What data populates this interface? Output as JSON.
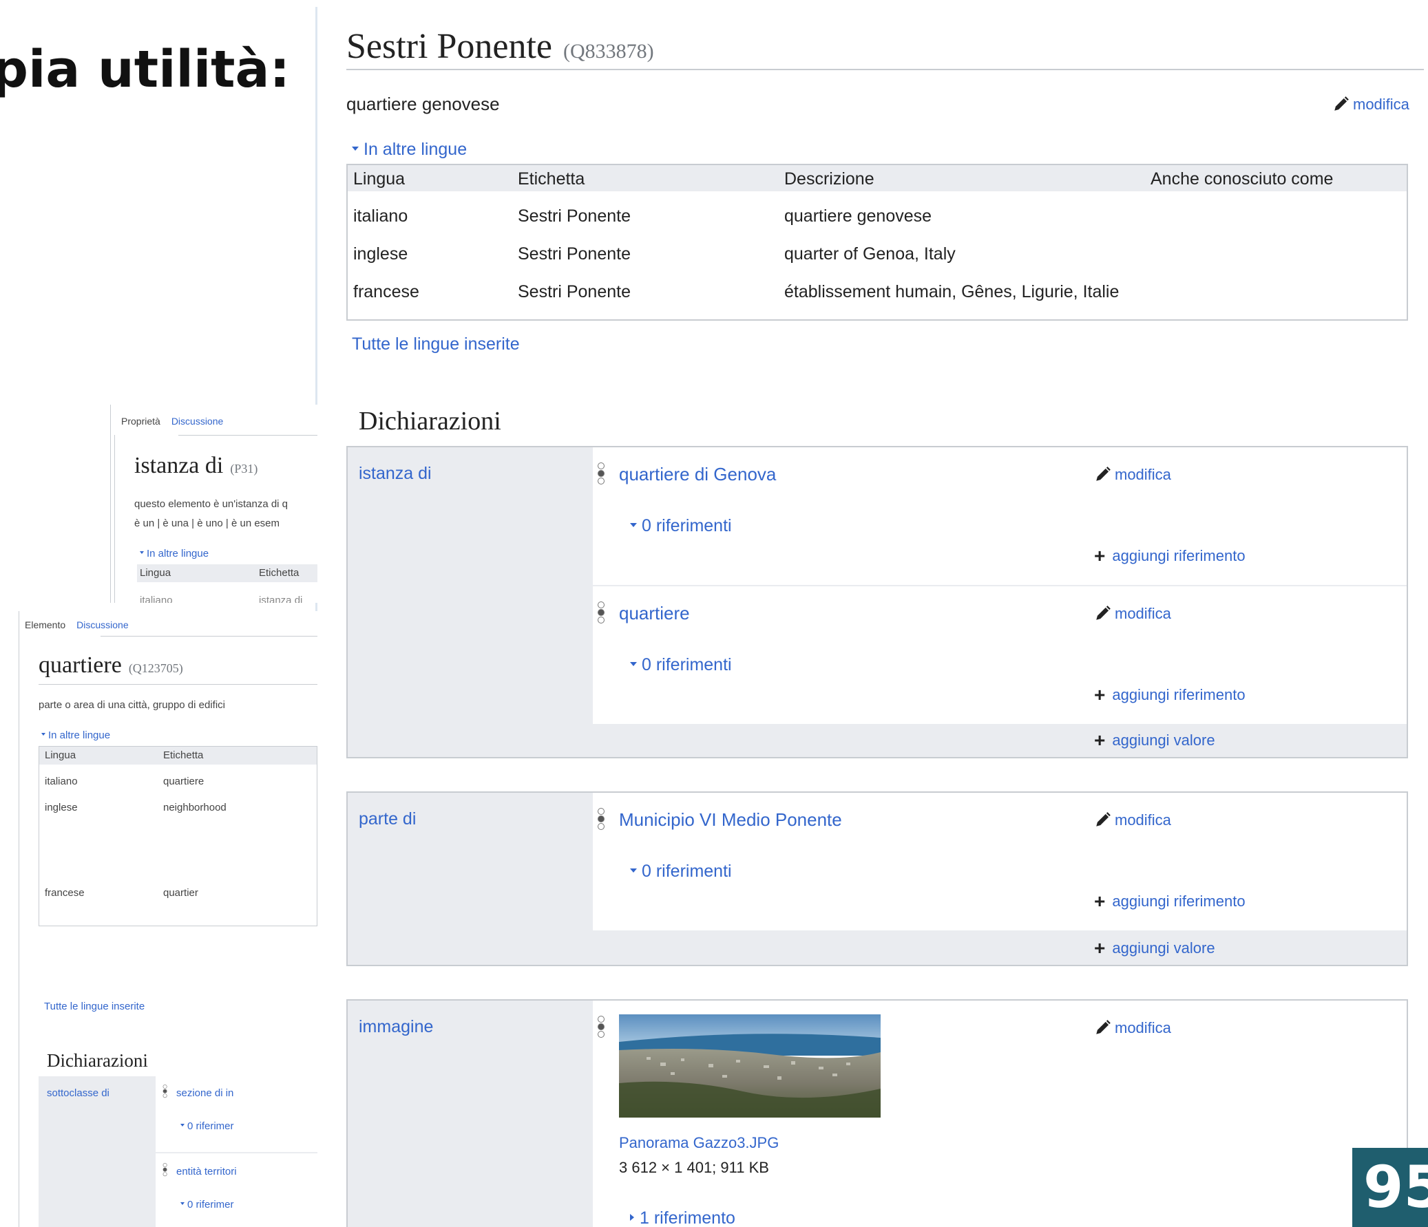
{
  "slide": {
    "title": "pia utilità:",
    "page_number": "95"
  },
  "main": {
    "label": "Sestri Ponente",
    "qid": "(Q833878)",
    "description": "quartiere genovese",
    "edit_label": "modifica",
    "other_languages": "In altre lingue",
    "table": {
      "headers": [
        "Lingua",
        "Etichetta",
        "Descrizione",
        "Anche conosciuto come"
      ],
      "rows": [
        {
          "lang": "italiano",
          "label": "Sestri Ponente",
          "desc": "quartiere genovese"
        },
        {
          "lang": "inglese",
          "label": "Sestri Ponente",
          "desc": "quarter of Genoa, Italy"
        },
        {
          "lang": "francese",
          "label": "Sestri Ponente",
          "desc": "établissement humain, Gênes, Ligurie, Italie"
        }
      ]
    },
    "all_languages": "Tutte le lingue inserite",
    "declarations": "Dichiarazioni",
    "add_reference": "aggiungi riferimento",
    "add_value": "aggiungi valore",
    "groups": [
      {
        "property": "istanza di",
        "statements": [
          {
            "value": "quartiere di Genova",
            "refs": "0 riferimenti"
          },
          {
            "value": "quartiere",
            "refs": "0 riferimenti"
          }
        ]
      },
      {
        "property": "parte di",
        "statements": [
          {
            "value": "Municipio VI Medio Ponente",
            "refs": "0 riferimenti"
          }
        ]
      },
      {
        "property": "immagine",
        "statements": [
          {
            "file": "Panorama Gazzo3.JPG",
            "file_info": "3 612 × 1 401; 911 KB",
            "refs": "1 riferimento"
          }
        ]
      }
    ]
  },
  "back_card_property": {
    "tabs": [
      "Proprietà",
      "Discussione"
    ],
    "label": "istanza di",
    "pid": "(P31)",
    "description": "questo elemento è un'istanza di q",
    "aliases": "è un | è una | è uno | è un esem",
    "other_languages": "In altre lingue",
    "headers": [
      "Lingua",
      "Etichetta"
    ],
    "partial_row": [
      "italiano",
      "istanza di"
    ]
  },
  "back_card_item": {
    "tabs": [
      "Elemento",
      "Discussione"
    ],
    "label": "quartiere",
    "qid": "(Q123705)",
    "description": "parte o area di una città, gruppo di edifici",
    "other_languages": "In altre lingue",
    "headers": [
      "Lingua",
      "Etichetta"
    ],
    "rows": [
      [
        "italiano",
        "quartiere"
      ],
      [
        "inglese",
        "neighborhood"
      ],
      [
        "francese",
        "quartier"
      ]
    ],
    "all_languages": "Tutte le lingue inserite",
    "declarations": "Dichiarazioni",
    "property": "sottoclasse di",
    "values": [
      "sezione di in",
      "entità territori"
    ],
    "refs": "0 riferimer"
  },
  "colors": {
    "link": "#3366cc",
    "border": "#c8ccd1",
    "group_bg": "#eaecf0",
    "badge": "#1f5e6e"
  }
}
